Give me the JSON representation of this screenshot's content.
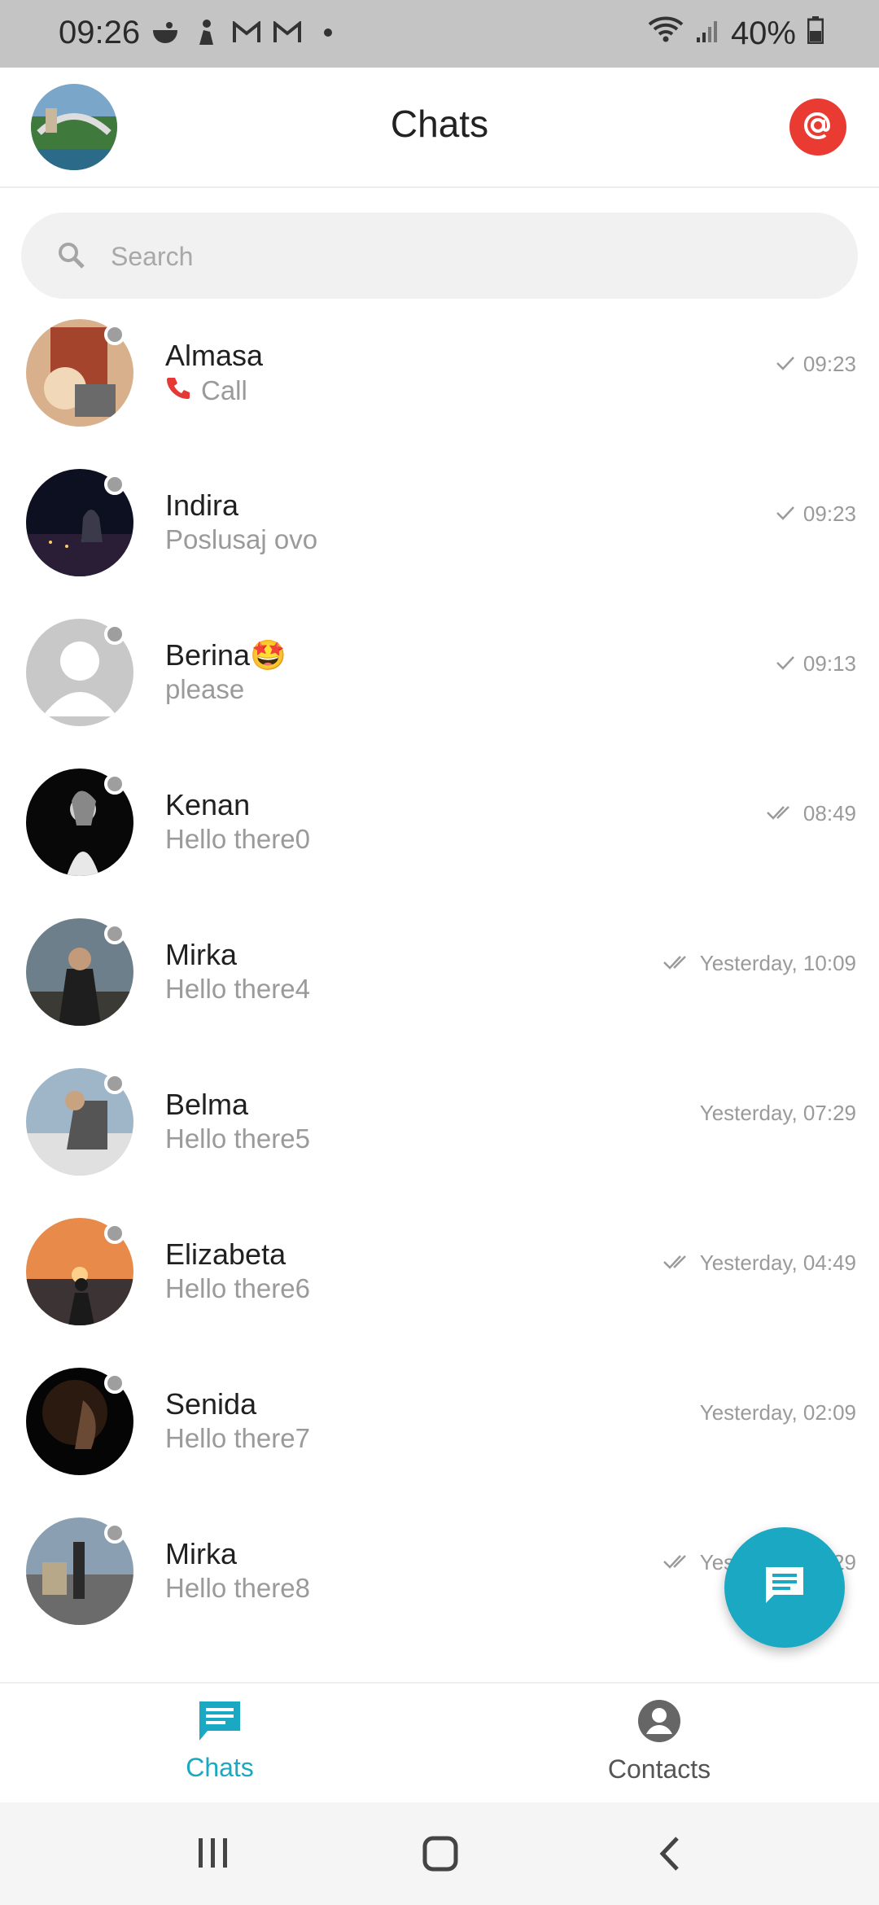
{
  "status_bar": {
    "time": "09:26",
    "battery": "40%"
  },
  "header": {
    "title": "Chats"
  },
  "search": {
    "placeholder": "Search"
  },
  "chats": [
    {
      "name": "Almasa",
      "message": "Call",
      "time": "09:23",
      "check": "single",
      "call": true,
      "avatar": "illustration"
    },
    {
      "name": "Indira",
      "message": "Poslusaj ovo",
      "time": "09:23",
      "check": "single",
      "avatar": "night-city"
    },
    {
      "name": "Berina🤩",
      "message": "please",
      "time": "09:13",
      "check": "single",
      "avatar": "placeholder"
    },
    {
      "name": "Kenan",
      "message": "Hello there0",
      "time": "08:49",
      "check": "double",
      "avatar": "portrait-dark"
    },
    {
      "name": "Mirka",
      "message": "Hello there4",
      "time": "Yesterday, 10:09",
      "check": "double",
      "avatar": "photographer"
    },
    {
      "name": "Belma",
      "message": "Hello there5",
      "time": "Yesterday, 07:29",
      "check": "none",
      "avatar": "man-table"
    },
    {
      "name": "Elizabeta",
      "message": "Hello there6",
      "time": "Yesterday, 04:49",
      "check": "double",
      "avatar": "sunset"
    },
    {
      "name": "Senida",
      "message": "Hello there7",
      "time": "Yesterday, 02:09",
      "check": "none",
      "avatar": "profile-woman"
    },
    {
      "name": "Mirka",
      "message": "Hello there8",
      "time": "Yesterday, 12:29",
      "check": "double",
      "avatar": "statue"
    }
  ],
  "bottom_nav": {
    "chats": "Chats",
    "contacts": "Contacts"
  },
  "colors": {
    "accent": "#1ba8c2",
    "mention": "#ea3b33",
    "call": "#e53935"
  }
}
